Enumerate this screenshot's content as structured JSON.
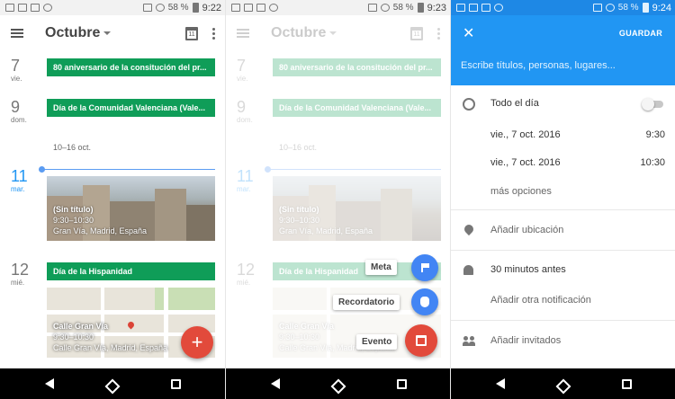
{
  "status_bars": [
    {
      "battery": "58 %",
      "time": "9:22"
    },
    {
      "battery": "58 %",
      "time": "9:23"
    },
    {
      "battery": "58 %",
      "time": "9:24"
    }
  ],
  "agenda": {
    "month": "Octubre",
    "days": [
      {
        "num": "7",
        "name": "vie.",
        "event": "80 aniversario de la consitución del pr..."
      },
      {
        "num": "9",
        "name": "dom.",
        "event": "Día de la Comunidad Valenciana (Vale..."
      },
      {
        "num": "11",
        "name": "mar."
      },
      {
        "num": "12",
        "name": "mié.",
        "event": "Día de la Hispanidad"
      }
    ],
    "week_range": "10–16 oct.",
    "photo_event": {
      "title": "(Sin título)",
      "time": "9:30–10:30",
      "place": "Gran Vía, Madrid, España"
    },
    "map_event": {
      "title": "Calle Gran Vía",
      "time": "9:30–10:30",
      "place": "Calle Gran Vía, Madrid, España"
    },
    "fab_label": "+"
  },
  "speed_dial": {
    "goal_label": "Meta",
    "reminder_label": "Recordatorio",
    "event_label": "Evento"
  },
  "editor": {
    "close_label": "✕",
    "save_label": "GUARDAR",
    "title_placeholder": "Escribe títulos, personas, lugares...",
    "all_day_label": "Todo el día",
    "start_date": "vie., 7 oct. 2016",
    "start_time": "9:30",
    "end_date": "vie., 7 oct. 2016",
    "end_time": "10:30",
    "more_options": "más opciones",
    "location": "Añadir ubicación",
    "notification": "30 minutos antes",
    "add_notification": "Añadir otra notificación",
    "guests": "Añadir invitados"
  },
  "colors": {
    "event_green": "#0f9d58",
    "accent_blue": "#2196f3",
    "fab_red": "#e24a3b"
  }
}
